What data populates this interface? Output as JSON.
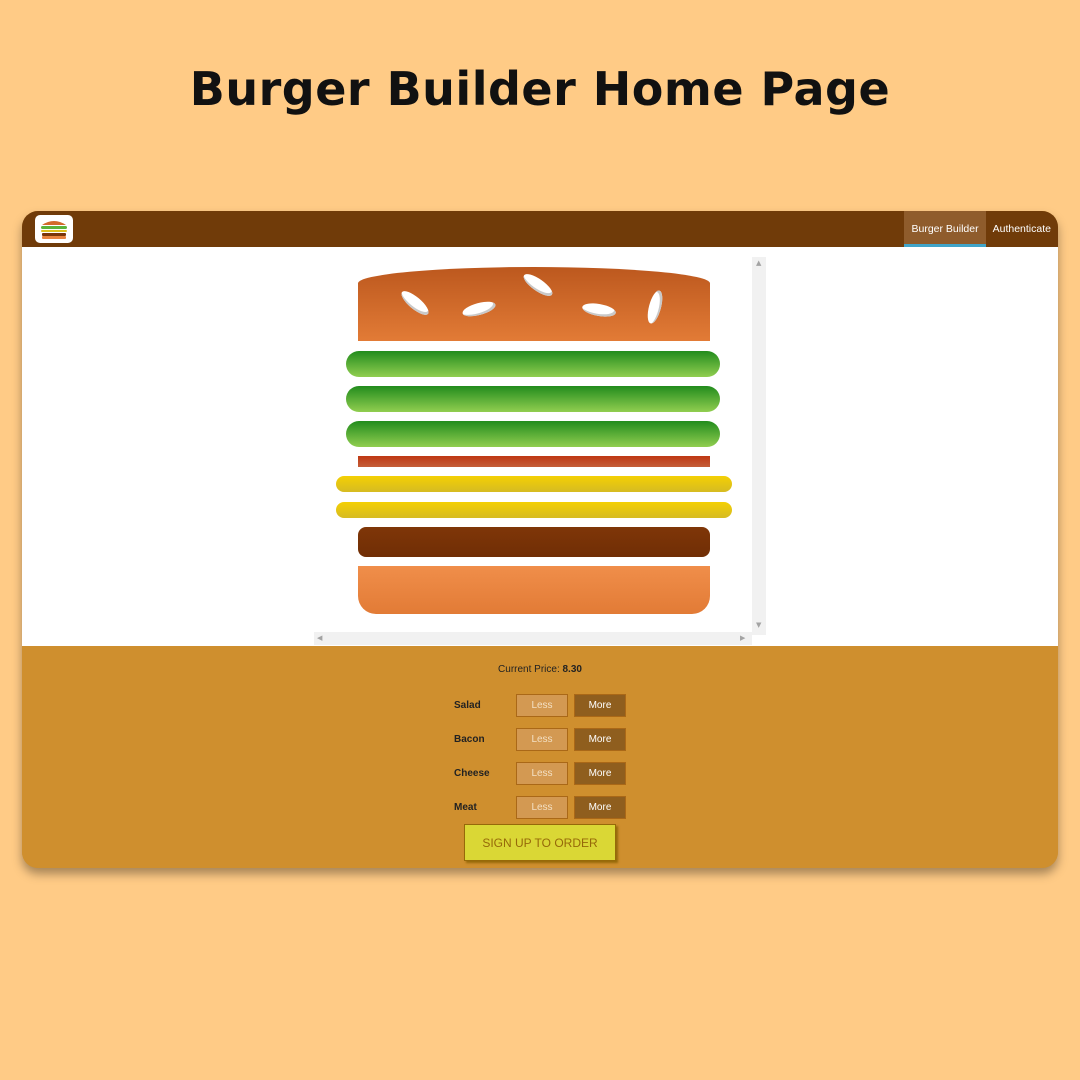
{
  "page": {
    "heading": "Burger Builder Home Page"
  },
  "toolbar": {
    "logo_icon": "burger-logo-icon",
    "nav": [
      {
        "label": "Burger Builder",
        "active": true
      },
      {
        "label": "Authenticate",
        "active": false
      }
    ]
  },
  "burger": {
    "ingredients": [
      "salad",
      "salad",
      "salad",
      "bacon",
      "cheese",
      "cheese",
      "meat"
    ]
  },
  "build_controls": {
    "price_label": "Current Price:",
    "price_value": "8.30",
    "controls": [
      {
        "label": "Salad",
        "less": "Less",
        "more": "More"
      },
      {
        "label": "Bacon",
        "less": "Less",
        "more": "More"
      },
      {
        "label": "Cheese",
        "less": "Less",
        "more": "More"
      },
      {
        "label": "Meat",
        "less": "Less",
        "more": "More"
      }
    ],
    "order_button": "SIGN UP TO ORDER"
  },
  "colors": {
    "background": "#FFCB86",
    "toolbar": "#703B09",
    "controls": "#CF8F2E",
    "order_button": "#DAD735"
  }
}
